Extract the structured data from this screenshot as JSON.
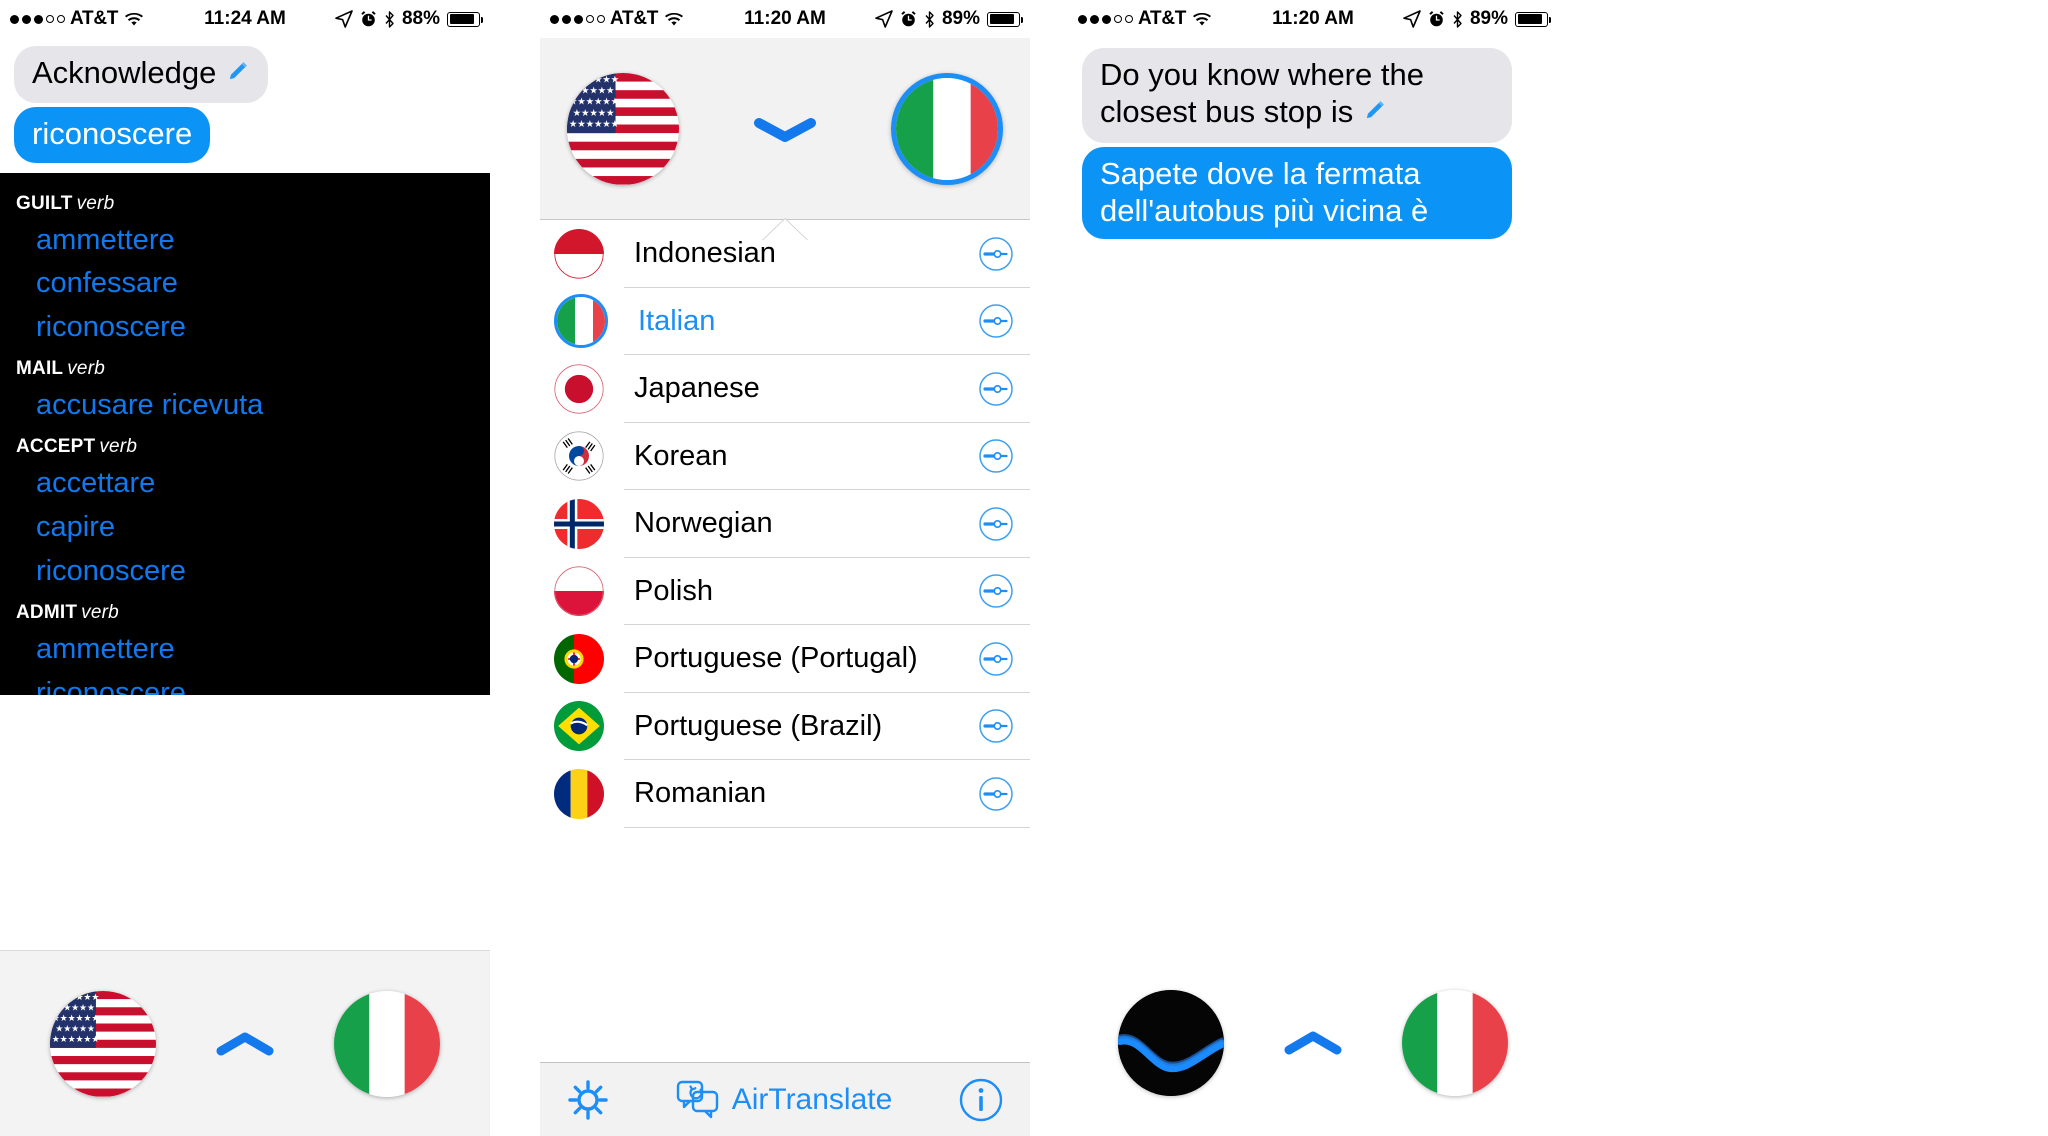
{
  "app": {
    "name": "AirTranslate"
  },
  "colors": {
    "ios_blue": "#0b93f6",
    "tint_blue": "#1d8ef5",
    "bubble_grey": "#e5e5ea",
    "dict_bg": "#000000",
    "dict_link": "#1178ed",
    "toolbar_bg": "#f2f2f2"
  },
  "panel1": {
    "statusbar": {
      "carrier": "AT&T",
      "signal_dots_filled": 3,
      "signal_dots_total": 5,
      "time": "11:24 AM",
      "battery_percent": "88%",
      "icons": [
        "location-arrow-icon",
        "alarm-clock-icon",
        "bluetooth-icon",
        "battery-icon"
      ]
    },
    "messages": [
      {
        "side": "left",
        "style": "grey",
        "text": "Acknowledge",
        "has_pencil": true
      },
      {
        "side": "left",
        "style": "blue",
        "text": "riconoscere",
        "has_pencil": false
      }
    ],
    "dictionary": [
      {
        "headword": "GUILT",
        "pos": "verb",
        "entries": [
          "ammettere",
          "confessare",
          "riconoscere"
        ]
      },
      {
        "headword": "MAIL",
        "pos": "verb",
        "entries": [
          "accusare ricevuta"
        ]
      },
      {
        "headword": "ACCEPT",
        "pos": "verb",
        "entries": [
          "accettare",
          "capire",
          "riconoscere"
        ]
      },
      {
        "headword": "ADMIT",
        "pos": "verb",
        "entries": [
          "ammettere",
          "riconoscere"
        ]
      }
    ],
    "flagbar": {
      "source_flag": "us-flag",
      "target_flag": "italy-flag",
      "chevron": "chevron-up-icon"
    }
  },
  "panel2": {
    "statusbar": {
      "carrier": "AT&T",
      "signal_dots_filled": 3,
      "signal_dots_total": 5,
      "time": "11:20 AM",
      "battery_percent": "89%"
    },
    "header": {
      "source_flag": "us-flag",
      "target_flag": "italy-flag",
      "target_selected": true,
      "chevron": "chevron-down-icon"
    },
    "languages": [
      {
        "name": "Indonesian",
        "flag": "indonesia-flag",
        "selected": false
      },
      {
        "name": "Italian",
        "flag": "italy-flag",
        "selected": true
      },
      {
        "name": "Japanese",
        "flag": "japan-flag",
        "selected": false
      },
      {
        "name": "Korean",
        "flag": "korea-flag",
        "selected": false
      },
      {
        "name": "Norwegian",
        "flag": "norway-flag",
        "selected": false
      },
      {
        "name": "Polish",
        "flag": "poland-flag",
        "selected": false
      },
      {
        "name": "Portuguese (Portugal)",
        "flag": "portugal-flag",
        "selected": false
      },
      {
        "name": "Portuguese (Brazil)",
        "flag": "brazil-flag",
        "selected": false
      },
      {
        "name": "Romanian",
        "flag": "romania-flag",
        "selected": false
      }
    ],
    "toolbar": {
      "settings_icon": "gear-icon",
      "brand_icon": "chat-refresh-icon",
      "brand_label": "AirTranslate",
      "info_icon": "info-circle-icon"
    }
  },
  "panel3": {
    "statusbar": {
      "carrier": "AT&T",
      "signal_dots_filled": 3,
      "signal_dots_total": 5,
      "time": "11:20 AM",
      "battery_percent": "89%"
    },
    "messages": [
      {
        "side": "left",
        "style": "grey",
        "text": "Do you know where the closest bus stop is",
        "has_pencil": true
      },
      {
        "side": "left",
        "style": "blue",
        "text": "Sapete dove la fermata dell'autobus più vicina è",
        "has_pencil": false
      }
    ],
    "flagbar": {
      "source_icon": "siri-waveform-icon",
      "target_flag": "italy-flag",
      "chevron": "chevron-up-icon"
    }
  }
}
